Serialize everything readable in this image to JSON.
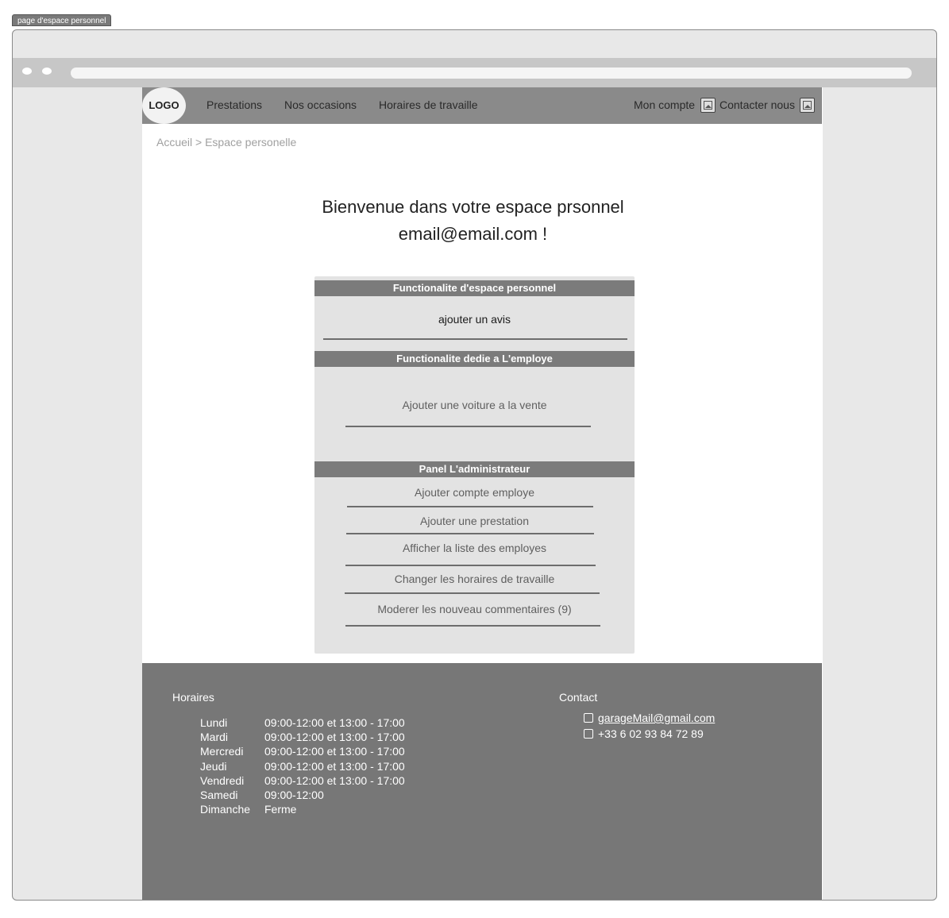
{
  "frame": {
    "label": "page d'espace personnel"
  },
  "nav": {
    "logo": "LOGO",
    "links": [
      "Prestations",
      "Nos occasions",
      "Horaires de travaille"
    ],
    "account": "Mon compte",
    "contact": "Contacter nous"
  },
  "breadcrumb": "Accueil > Espace personelle",
  "welcome": {
    "line1": "Bienvenue dans votre espace prsonnel",
    "line2": "email@email.com !"
  },
  "panel": {
    "section1": {
      "title": "Functionalite d'espace personnel",
      "actions": [
        "ajouter un avis"
      ]
    },
    "section2": {
      "title": "Functionalite dedie a L'employe",
      "actions": [
        "Ajouter une voiture a la vente"
      ]
    },
    "section3": {
      "title": "Panel L'administrateur",
      "actions": [
        "Ajouter compte employe",
        "Ajouter une prestation",
        "Afficher la liste des employes",
        "Changer les horaires de travaille",
        "Moderer les nouveau commentaires (9)"
      ]
    }
  },
  "footer": {
    "hours_title": "Horaires",
    "hours": [
      {
        "day": "Lundi",
        "time": "09:00-12:00 et 13:00 - 17:00"
      },
      {
        "day": "Mardi",
        "time": "09:00-12:00 et 13:00 - 17:00"
      },
      {
        "day": "Mercredi",
        "time": "09:00-12:00 et 13:00 - 17:00"
      },
      {
        "day": "Jeudi",
        "time": "09:00-12:00 et 13:00 - 17:00"
      },
      {
        "day": "Vendredi",
        "time": "09:00-12:00 et 13:00 - 17:00"
      },
      {
        "day": "Samedi",
        "time": "09:00-12:00"
      },
      {
        "day": "Dimanche",
        "time": "Ferme"
      }
    ],
    "contact_title": "Contact",
    "email": "garageMail@gmail.com",
    "phone": "+33 6 02 93 84 72 89"
  },
  "colors": {
    "nav": "#8a8a8a",
    "footer": "#777777",
    "section_head": "#7b7b7b",
    "panel": "#e3e3e3"
  }
}
